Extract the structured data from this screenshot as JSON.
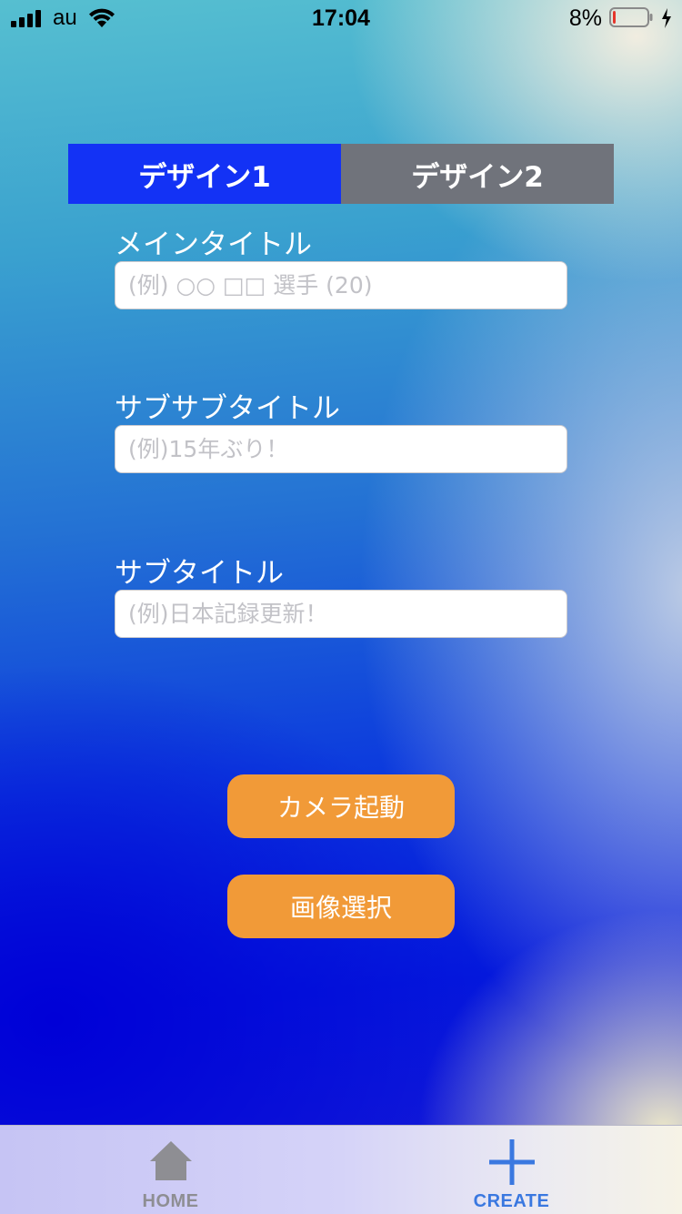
{
  "status_bar": {
    "carrier": "au",
    "time": "17:04",
    "battery_percent": "8%",
    "battery_level": 0.08,
    "icons": [
      "signal-icon",
      "wifi-icon",
      "battery-icon",
      "charging-bolt-icon"
    ]
  },
  "segment": {
    "tabs": [
      {
        "label": "デザイン1",
        "selected": true
      },
      {
        "label": "デザイン2",
        "selected": false
      }
    ],
    "active_color": "#1332f5",
    "inactive_color": "#70737b"
  },
  "form": {
    "main_title": {
      "label": "メインタイトル",
      "value": "",
      "placeholder": "(例) ○○ □□ 選手 (20)"
    },
    "subsub_title": {
      "label": "サブサブタイトル",
      "value": "",
      "placeholder": "(例)15年ぶり！"
    },
    "sub_title": {
      "label": "サブタイトル",
      "value": "",
      "placeholder": "(例)日本記録更新！"
    }
  },
  "actions": {
    "camera_label": "カメラ起動",
    "image_select_label": "画像選択",
    "button_color": "#f19a38"
  },
  "tab_bar": {
    "items": [
      {
        "label": "HOME",
        "icon": "home-icon",
        "color": "#8e8e93"
      },
      {
        "label": "CREATE",
        "icon": "plus-icon",
        "color": "#3a78e0",
        "selected": true
      }
    ]
  }
}
